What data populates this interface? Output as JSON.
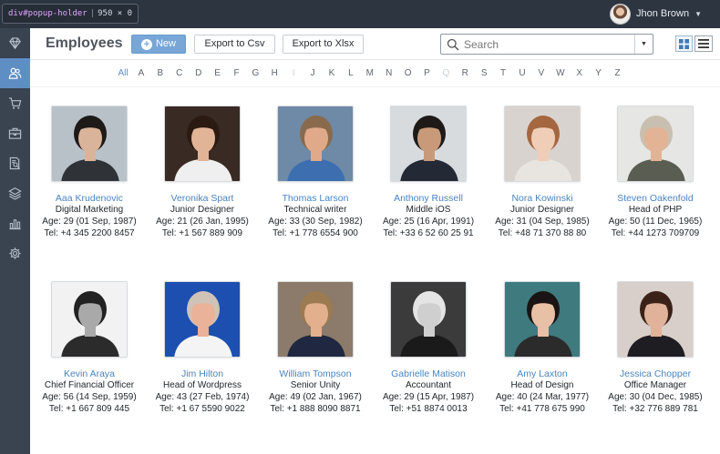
{
  "devtools": {
    "element": "div#popup-holder",
    "size": "950 × 0"
  },
  "user": {
    "name": "Jhon Brown"
  },
  "page": {
    "title": "Employees"
  },
  "toolbar": {
    "new_label": "New",
    "csv_label": "Export to Csv",
    "xlsx_label": "Export to Xlsx"
  },
  "search": {
    "placeholder": "Search",
    "value": ""
  },
  "sidebar": {
    "items": [
      "diamond-icon",
      "users-icon",
      "cart-icon",
      "briefcase-icon",
      "report-icon",
      "layers-icon",
      "bar-chart-icon",
      "gear-icon"
    ],
    "active_index": 1
  },
  "alphabet": {
    "letters": [
      "All",
      "A",
      "B",
      "C",
      "D",
      "E",
      "F",
      "G",
      "H",
      "I",
      "J",
      "K",
      "L",
      "M",
      "N",
      "O",
      "P",
      "Q",
      "R",
      "S",
      "T",
      "U",
      "V",
      "W",
      "X",
      "Y",
      "Z"
    ],
    "active": "All",
    "disabled": [
      "I",
      "Q"
    ]
  },
  "colors": {
    "accent": "#5e8ec4",
    "sidebar": "#3a4350",
    "topbar": "#2d3541",
    "name_link": "#4a84c2"
  },
  "employees": [
    {
      "name": "Aaa Krudenovic",
      "title": "Digital Marketing",
      "age": "Age: 29 (01 Sep, 1987)",
      "tel": "Tel: +4 345 2200 8457",
      "bg": "#b9c1c8",
      "skin": "#d9b49a",
      "hair": "#1e1a18",
      "shirt": "#2f3338"
    },
    {
      "name": "Veronika Spart",
      "title": "Junior Designer",
      "age": "Age: 21 (26 Jan, 1995)",
      "tel": "Tel: +1 567 889 909",
      "bg": "#3a2a24",
      "skin": "#e2b497",
      "hair": "#2a1a12",
      "shirt": "#efefef"
    },
    {
      "name": "Thomas Larson",
      "title": "Technical writer",
      "age": "Age: 33 (30 Sep, 1982)",
      "tel": "Tel: +1 778 6554 900",
      "bg": "#6f8aa6",
      "skin": "#e0a98a",
      "hair": "#8a6a4c",
      "shirt": "#3d6fb0"
    },
    {
      "name": "Anthony Russell",
      "title": "Middle iOS",
      "age": "Age: 25 (16 Apr, 1991)",
      "tel": "Tel: +33 6 52 60 25 91",
      "bg": "#d8dbde",
      "skin": "#c99a7a",
      "hair": "#1f1a18",
      "shirt": "#232a36"
    },
    {
      "name": "Nora Kowinski",
      "title": "Junior Designer",
      "age": "Age: 31 (04 Sep, 1985)",
      "tel": "Tel: +48 71 370 88 80",
      "bg": "#d9d3cf",
      "skin": "#f0cdb7",
      "hair": "#a5673f",
      "shirt": "#e8e4e0"
    },
    {
      "name": "Steven Oakenfold",
      "title": "Head of PHP",
      "age": "Age: 50 (11 Dec, 1965)",
      "tel": "Tel: +44 1273 709709",
      "bg": "#e6e6e4",
      "skin": "#e2b394",
      "hair": "#c9bfb0",
      "shirt": "#5a5e52"
    },
    {
      "name": "Kevin Araya",
      "title": "Chief Financial Officer",
      "age": "Age: 56 (14 Sep, 1959)",
      "tel": "Tel: +1 667 809 445",
      "bg": "#f2f2f2",
      "skin": "#a9a9a9",
      "hair": "#222222",
      "shirt": "#2b2b2b"
    },
    {
      "name": "Jim Hilton",
      "title": "Head of Wordpress",
      "age": "Age: 43 (27 Feb, 1974)",
      "tel": "Tel: +1 67 5590 9022",
      "bg": "#1d4fb0",
      "skin": "#e9b299",
      "hair": "#cfc3b8",
      "shirt": "#f4f4f4"
    },
    {
      "name": "William Tompson",
      "title": "Senior Unity",
      "age": "Age: 49 (02 Jan, 1967)",
      "tel": "Tel: +1 888 8090 8871",
      "bg": "#8c7a6a",
      "skin": "#e3b08e",
      "hair": "#9c7a52",
      "shirt": "#1f2840"
    },
    {
      "name": "Gabrielle Matison",
      "title": "Accountant",
      "age": "Age: 29 (15 Apr, 1987)",
      "tel": "Tel: +51 8874 0013",
      "bg": "#3b3b3b",
      "skin": "#cfcfcf",
      "hair": "#e4e4e4",
      "shirt": "#1a1a1a"
    },
    {
      "name": "Amy Laxton",
      "title": "Head of Design",
      "age": "Age: 40 (24 Mar, 1977)",
      "tel": "Tel: +41 778 675 990",
      "bg": "#3f7a7e",
      "skin": "#e8c0a6",
      "hair": "#1a1414",
      "shirt": "#2b2b2b"
    },
    {
      "name": "Jessica Chopper",
      "title": "Office Manager",
      "age": "Age: 30 (04 Dec, 1985)",
      "tel": "Tel: +32 776 889 781",
      "bg": "#d8cfca",
      "skin": "#e0b299",
      "hair": "#3b2218",
      "shirt": "#1d1d22"
    }
  ]
}
